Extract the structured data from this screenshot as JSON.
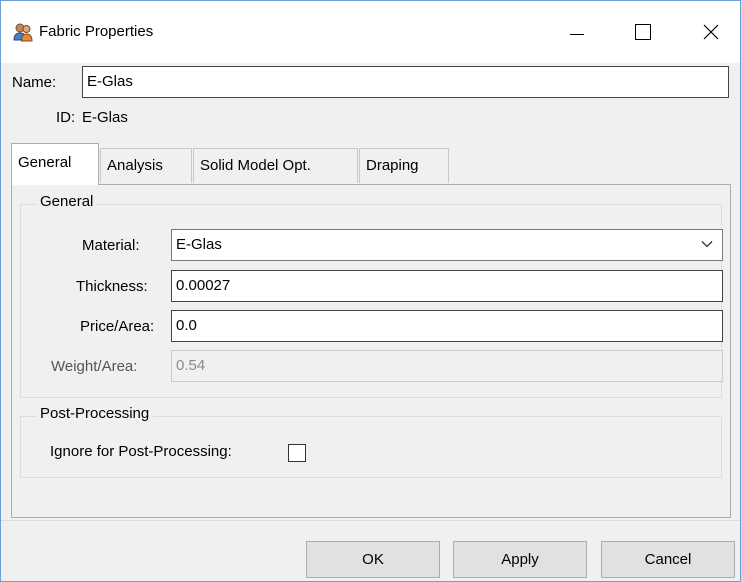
{
  "window": {
    "title": "Fabric Properties",
    "icon": "fabric-people-icon"
  },
  "header": {
    "name_label": "Name:",
    "name_value": "E-Glas",
    "id_label": "ID:",
    "id_value": "E-Glas"
  },
  "tabs": [
    {
      "label": "General",
      "active": true
    },
    {
      "label": "Analysis",
      "active": false
    },
    {
      "label": "Solid Model Opt.",
      "active": false
    },
    {
      "label": "Draping",
      "active": false
    }
  ],
  "general_group": {
    "title": "General",
    "material_label": "Material:",
    "material_value": "E-Glas",
    "thickness_label": "Thickness:",
    "thickness_value": "0.00027",
    "price_label": "Price/Area:",
    "price_value": "0.0",
    "weight_label": "Weight/Area:",
    "weight_value": "0.54"
  },
  "post_group": {
    "title": "Post-Processing",
    "ignore_label": "Ignore for Post-Processing:",
    "ignore_checked": false
  },
  "buttons": {
    "ok": "OK",
    "apply": "Apply",
    "cancel": "Cancel"
  }
}
